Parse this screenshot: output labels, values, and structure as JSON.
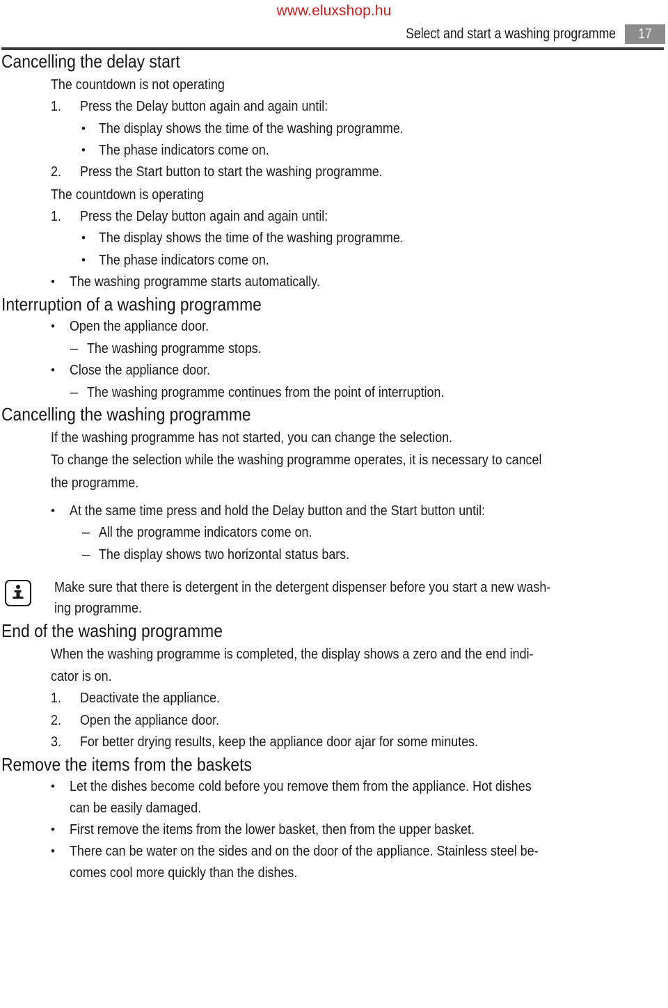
{
  "header": {
    "watermark": "www.eluxshop.hu",
    "title": "Select and start a washing programme",
    "page_number": "17",
    "badge_color": "#8c8c8c",
    "watermark_color": "#c62121",
    "rule_color": "#3a3a3a"
  },
  "markers": {
    "bullet": "•",
    "dash": "–",
    "num1": "1.",
    "num2": "2.",
    "num3": "3."
  },
  "sections": {
    "cancelling_delay_start": {
      "heading": "Cancelling the delay start",
      "sub_a": {
        "label": "The countdown is not operating",
        "step1": "Press the Delay button again and again until:",
        "step1_bullets": [
          "The display shows the time of the washing programme.",
          "The phase indicators come on."
        ],
        "step2": "Press the Start button to start the washing programme."
      },
      "sub_b": {
        "label": "The countdown is operating",
        "step1": "Press the Delay button again and again until:",
        "step1_bullets": [
          "The display shows the time of the washing programme.",
          "The phase indicators come on."
        ],
        "final_bullet": "The washing programme starts automatically."
      }
    },
    "interruption": {
      "heading": "Interruption of a washing programme",
      "items": [
        {
          "bullet": "Open the appliance door.",
          "dash": "The washing programme stops."
        },
        {
          "bullet": "Close the appliance door.",
          "dash": "The washing programme continues from the point of interruption."
        }
      ]
    },
    "cancelling_washing": {
      "heading": "Cancelling the washing programme",
      "para1": "If the washing programme has not started, you can change the selection.",
      "para2_line1": "To change the selection while the washing programme operates, it is necessary to cancel",
      "para2_line2": "the programme.",
      "bullet": "At the same time press and hold the Delay button and the Start button until:",
      "dashes": [
        "All the programme indicators come on.",
        "The display shows two horizontal status bars."
      ],
      "note_line1": "Make sure that there is detergent in the detergent dispenser before you start a new wash-",
      "note_line2": "ing programme.",
      "note_icon": "info-icon"
    },
    "end_of_programme": {
      "heading": "End of the washing programme",
      "intro_line1": "When the washing programme is completed, the display shows a zero and the end indi-",
      "intro_line2": "cator is on.",
      "steps": [
        "Deactivate the appliance.",
        "Open the appliance door.",
        "For better drying results, keep the appliance door ajar for some minutes."
      ]
    },
    "remove_items": {
      "heading": "Remove the items from the baskets",
      "bullets": [
        {
          "line1": "Let the dishes become cold before you remove them from the appliance. Hot dishes",
          "line2": "can be easily damaged."
        },
        {
          "line1": "First remove the items from the lower basket, then from the upper basket.",
          "line2": ""
        },
        {
          "line1": "There can be water on the sides and on the door of the appliance. Stainless steel be-",
          "line2": "comes cool more quickly than the dishes."
        }
      ]
    }
  }
}
